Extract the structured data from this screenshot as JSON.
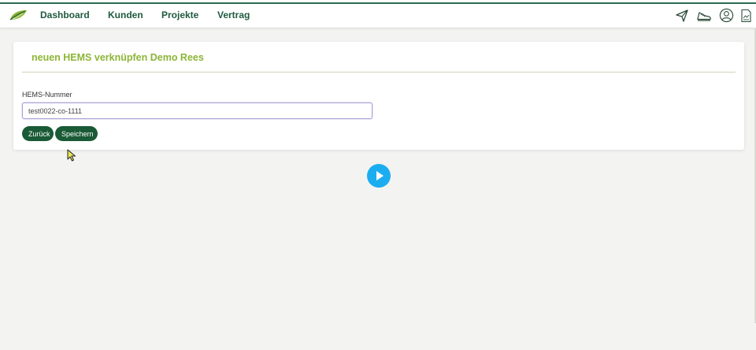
{
  "nav": {
    "links": [
      {
        "label": "Dashboard"
      },
      {
        "label": "Kunden"
      },
      {
        "label": "Projekte"
      },
      {
        "label": "Vertrag"
      }
    ],
    "icons": [
      "send-icon",
      "sneaker-icon",
      "user-profile-icon",
      "document-icon"
    ]
  },
  "form": {
    "title": "neuen HEMS verknüpfen Demo Rees",
    "hems_label": "HEMS-Nummer",
    "hems_value": "test0022-co-1111",
    "back_label": "Zurück",
    "save_label": "Speichern"
  },
  "colors": {
    "brand_green": "#1a5a36",
    "title_green": "#8cb537",
    "nav_text": "#1f5a3f",
    "play_blue": "#1cadf0",
    "input_focus": "#a9a2d6"
  }
}
